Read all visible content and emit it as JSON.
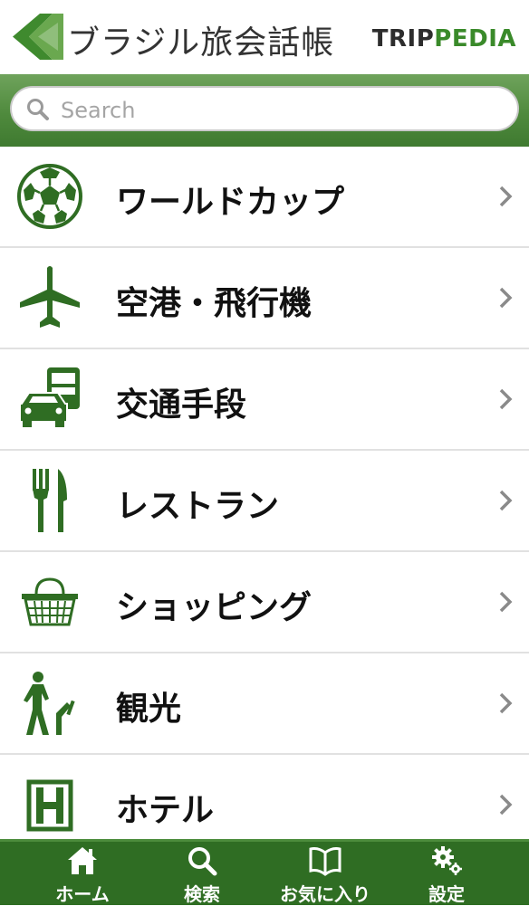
{
  "header": {
    "app_title": "ブラジル旅会話帳",
    "brand_part1": "TRIP",
    "brand_part2": "PEDIA"
  },
  "search": {
    "placeholder": "Search"
  },
  "menu": {
    "items": [
      {
        "label": "ワールドカップ",
        "icon": "soccer-ball-icon"
      },
      {
        "label": "空港・飛行機",
        "icon": "airplane-icon"
      },
      {
        "label": "交通手段",
        "icon": "transport-icon"
      },
      {
        "label": "レストラン",
        "icon": "fork-knife-icon"
      },
      {
        "label": "ショッピング",
        "icon": "shopping-basket-icon"
      },
      {
        "label": "観光",
        "icon": "sightseeing-icon"
      },
      {
        "label": "ホテル",
        "icon": "hotel-icon"
      }
    ]
  },
  "tabbar": {
    "tabs": [
      {
        "label": "ホーム",
        "icon": "home-icon"
      },
      {
        "label": "検索",
        "icon": "search-icon"
      },
      {
        "label": "お気に入り",
        "icon": "book-icon"
      },
      {
        "label": "設定",
        "icon": "gear-icon"
      }
    ]
  },
  "colors": {
    "accent_green": "#2f6d23",
    "search_bar_green": "#4f8a3d",
    "brand_green": "#3a8a2a"
  }
}
